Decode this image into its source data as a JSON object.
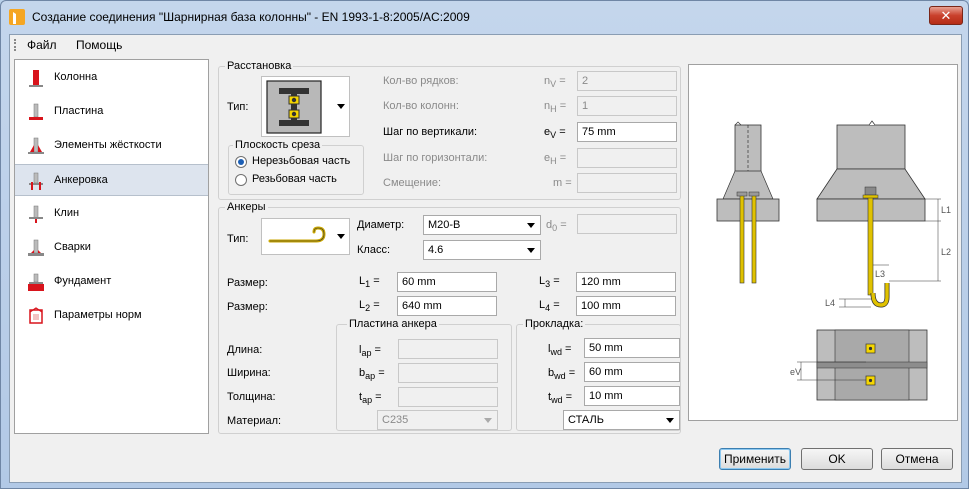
{
  "window": {
    "title": "Создание соединения \"Шарнирная база колонны\" - EN 1993-1-8:2005/AC:2009",
    "close_label": "✕"
  },
  "menu": {
    "file": "Файл",
    "help": "Помощь"
  },
  "sidebar": {
    "items": [
      {
        "label": "Колонна",
        "icon": "column-icon"
      },
      {
        "label": "Пластина",
        "icon": "plate-icon"
      },
      {
        "label": "Элементы жёсткости",
        "icon": "stiffeners-icon"
      },
      {
        "label": "Анкеровка",
        "icon": "anchorage-icon",
        "selected": true
      },
      {
        "label": "Клин",
        "icon": "wedge-icon"
      },
      {
        "label": "Сварки",
        "icon": "welds-icon"
      },
      {
        "label": "Фундамент",
        "icon": "foundation-icon"
      },
      {
        "label": "Параметры норм",
        "icon": "code-params-icon"
      }
    ]
  },
  "layout": {
    "title": "Расстановка",
    "type_label": "Тип:",
    "shear_plane": {
      "title": "Плоскость среза",
      "option1": "Нерезьбовая часть",
      "option2": "Резьбовая часть",
      "selected": "option1"
    },
    "rows_label": "Кол-во рядков:",
    "rows_sym": "n",
    "rows_sub": "V",
    "rows_value": "2",
    "cols_label": "Кол-во колонн:",
    "cols_sym": "n",
    "cols_sub": "H",
    "cols_value": "1",
    "vstep_label": "Шаг по вертикали:",
    "vstep_sym": "e",
    "vstep_sub": "V",
    "vstep_value": "75 mm",
    "hstep_label": "Шаг по горизонтали:",
    "hstep_sym": "e",
    "hstep_sub": "H",
    "hstep_value": "",
    "offset_label": "Смещение:",
    "offset_sym": "m",
    "offset_value": "",
    "eq": "="
  },
  "anchors": {
    "title": "Анкеры",
    "type_label": "Тип:",
    "diameter_label": "Диаметр:",
    "diameter_value": "M20-B",
    "class_label": "Класс:",
    "class_value": "4.6",
    "d0_sym": "d",
    "d0_sub": "0",
    "d0_value": "",
    "size_label": "Размер:",
    "l1_sym": "L",
    "l1_sub": "1",
    "l1_value": "60 mm",
    "l2_sym": "L",
    "l2_sub": "2",
    "l2_value": "640 mm",
    "l3_sym": "L",
    "l3_sub": "3",
    "l3_value": "120 mm",
    "l4_sym": "L",
    "l4_sub": "4",
    "l4_value": "100 mm",
    "eq": "="
  },
  "anchor_plate": {
    "title": "Пластина анкера",
    "length_label": "Длина:",
    "width_label": "Ширина:",
    "thickness_label": "Толщина:",
    "material_label": "Материал:",
    "lap_sym": "l",
    "lap_sub": "ap",
    "bap_sym": "b",
    "bap_sub": "ap",
    "tap_sym": "t",
    "tap_sub": "ap",
    "material_value": "C235"
  },
  "washer": {
    "title": "Прокладка:",
    "lwd_sym": "l",
    "lwd_sub": "wd",
    "lwd_value": "50 mm",
    "bwd_sym": "b",
    "bwd_sub": "wd",
    "bwd_value": "60 mm",
    "twd_sym": "t",
    "twd_sub": "wd",
    "twd_value": "10 mm",
    "material_value": "СТАЛЬ"
  },
  "preview": {
    "l1": "L1",
    "l2": "L2",
    "l3": "L3",
    "l4": "L4",
    "ev": "eV"
  },
  "buttons": {
    "apply": "Применить",
    "ok": "OK",
    "cancel": "Отмена"
  }
}
